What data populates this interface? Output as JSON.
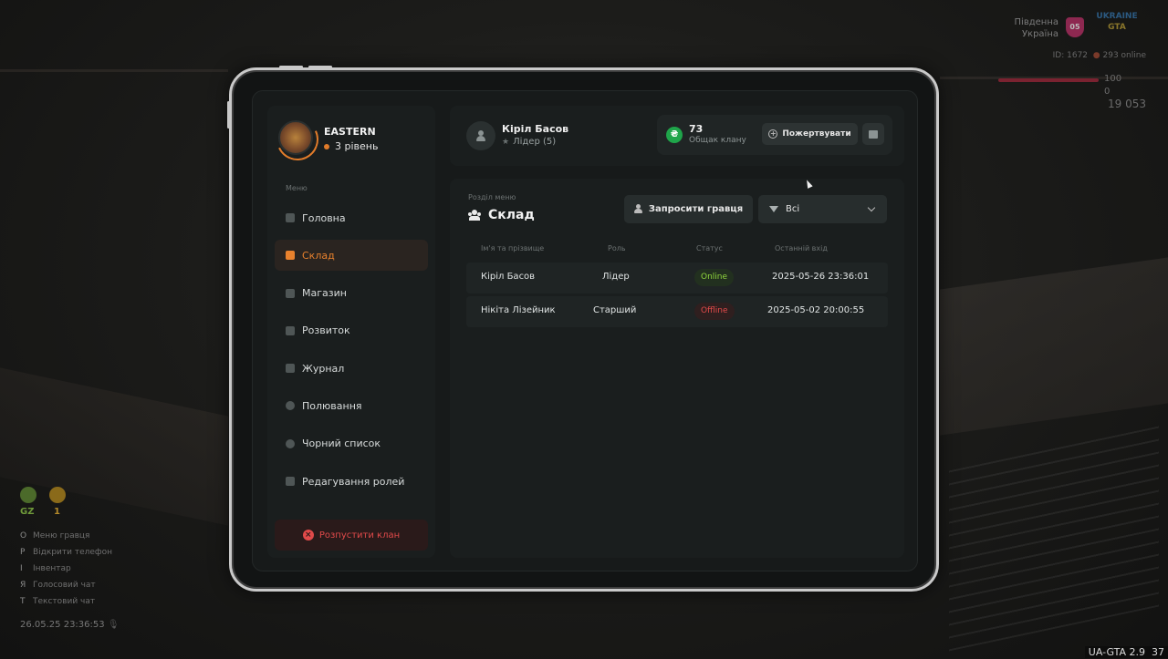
{
  "hud": {
    "server_name": "Південна Україна",
    "server_badge": "05",
    "logo_top": "UKRAINE",
    "logo_bottom": "GTA",
    "player_id_line": "ID: 1672",
    "online_line": "293 online",
    "health": "100",
    "armor": "0",
    "money": "19 053",
    "gz_label": "GZ",
    "gz_value": "1",
    "help": [
      {
        "key": "O",
        "label": "Меню гравця"
      },
      {
        "key": "P",
        "label": "Відкрити телефон"
      },
      {
        "key": "I",
        "label": "Інвентар"
      },
      {
        "key": "Я",
        "label": "Голосовий чат"
      },
      {
        "key": "T",
        "label": "Текстовий чат"
      }
    ],
    "datetime": "26.05.25 23:36:53",
    "version": "UA-GTA 2.9",
    "fps": "37"
  },
  "clan": {
    "name": "EASTERN",
    "level": "3 рівень"
  },
  "menu": {
    "title": "Меню",
    "items": [
      {
        "label": "Головна",
        "icon": "home-icon",
        "active": false
      },
      {
        "label": "Склад",
        "icon": "group-icon",
        "active": true
      },
      {
        "label": "Магазин",
        "icon": "basket-icon",
        "active": false
      },
      {
        "label": "Розвиток",
        "icon": "chart-icon",
        "active": false
      },
      {
        "label": "Журнал",
        "icon": "book-icon",
        "active": false
      },
      {
        "label": "Полювання",
        "icon": "target-icon",
        "active": false
      },
      {
        "label": "Чорний список",
        "icon": "block-icon",
        "active": false
      },
      {
        "label": "Редагування ролей",
        "icon": "user-edit-icon",
        "active": false
      }
    ],
    "disband_label": "Розпустити клан"
  },
  "profile": {
    "name": "Кіріл Басов",
    "role": "Лідер (5)"
  },
  "bank": {
    "amount": "73",
    "label": "Общак клану",
    "donate_label": "Пожертвувати"
  },
  "section": {
    "subtitle": "Розділ меню",
    "title": "Склад",
    "invite_label": "Запросити гравця",
    "filter_value": "Всі"
  },
  "table": {
    "headers": [
      "Ім'я та прізвище",
      "Роль",
      "Статус",
      "Останній вхід"
    ],
    "rows": [
      {
        "name": "Кіріл Басов",
        "role": "Лідер",
        "status": "Online",
        "last": "2025-05-26 23:36:01"
      },
      {
        "name": "Нікіта Лізейник",
        "role": "Старший",
        "status": "Offline",
        "last": "2025-05-02 20:00:55"
      }
    ]
  },
  "colors": {
    "accent": "#e8812d",
    "online": "#8fd63d",
    "offline": "#e24a4a",
    "coin": "#1fa54a"
  }
}
